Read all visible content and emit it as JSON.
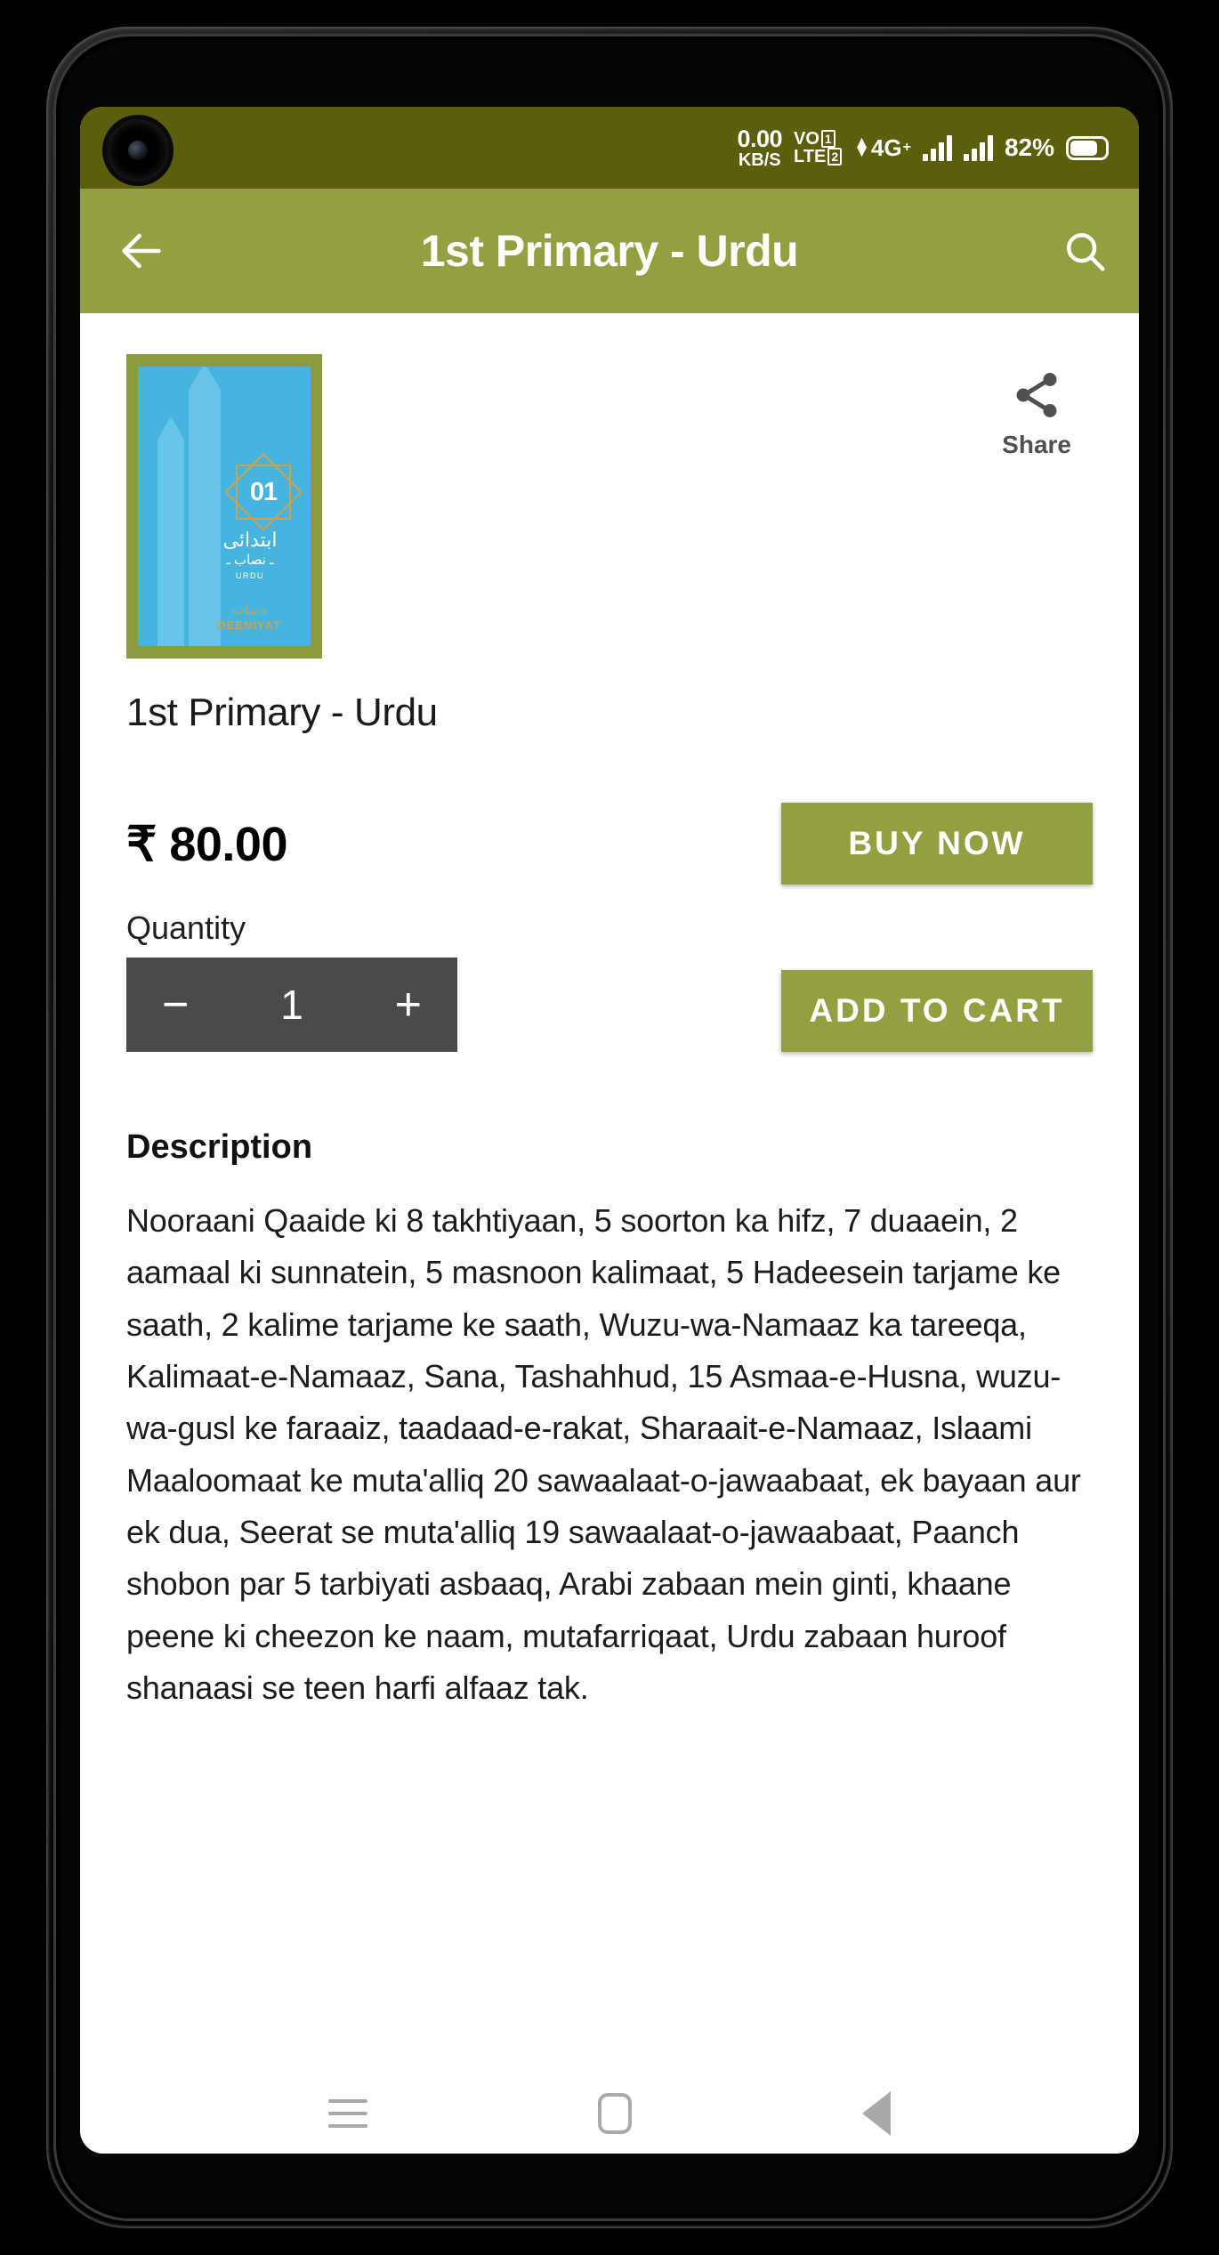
{
  "statusbar": {
    "net_speed_value": "0.00",
    "net_speed_unit": "KB/S",
    "volte_line1": "VO",
    "volte_sim1": "1",
    "volte_line2": "LTE",
    "volte_sim2": "2",
    "network_type": "4G",
    "network_suffix": "+",
    "battery_percent": "82%"
  },
  "appbar": {
    "back_icon": "back-arrow-icon",
    "title": "1st Primary - Urdu",
    "search_icon": "search-icon",
    "color": "#94a03f"
  },
  "product": {
    "cover": {
      "border_color": "#8d9a3e",
      "background_color": "#45b4de",
      "badge_number": "01",
      "urdu_title": "ابتدائی",
      "urdu_subtitle": "ـ نصاب ـ",
      "language_label": "URDU",
      "brand_mark": "دینیات",
      "brand_name": "DEENIYAT"
    },
    "share": {
      "icon": "share-icon",
      "label": "Share"
    },
    "title": "1st Primary - Urdu",
    "price": "₹ 80.00",
    "buy_now_label": "BUY NOW",
    "quantity_label": "Quantity",
    "quantity_value": "1",
    "decrement_label": "−",
    "increment_label": "+",
    "add_to_cart_label": "ADD TO CART",
    "description_heading": "Description",
    "description_body": "Nooraani Qaaide ki 8 takhtiyaan, 5 soorton ka hifz, 7 duaaein, 2 aamaal ki sunnatein, 5 masnoon kalimaat, 5 Hadeesein tarjame ke saath, 2 kalime tarjame ke saath, Wuzu-wa-Namaaz ka tareeqa, Kalimaat-e-Namaaz, Sana, Tashahhud, 15 Asmaa-e-Husna, wuzu-wa-gusl ke faraaiz, taadaad-e-rakat, Sharaait-e-Namaaz, Islaami Maaloomaat ke muta'alliq 20 sawaalaat-o-jawaabaat, ek bayaan aur ek dua, Seerat se muta'alliq 19 sawaalaat-o-jawaabaat, Paanch shobon par 5 tarbiyati asbaaq, Arabi zabaan mein ginti, khaane peene ki cheezon ke naam, mutafarriqaat, Urdu zabaan huroof shanaasi se teen harfi alfaaz tak."
  },
  "navbar": {
    "recents_icon": "recents-menu-icon",
    "home_icon": "home-square-icon",
    "back_icon": "back-triangle-icon"
  }
}
